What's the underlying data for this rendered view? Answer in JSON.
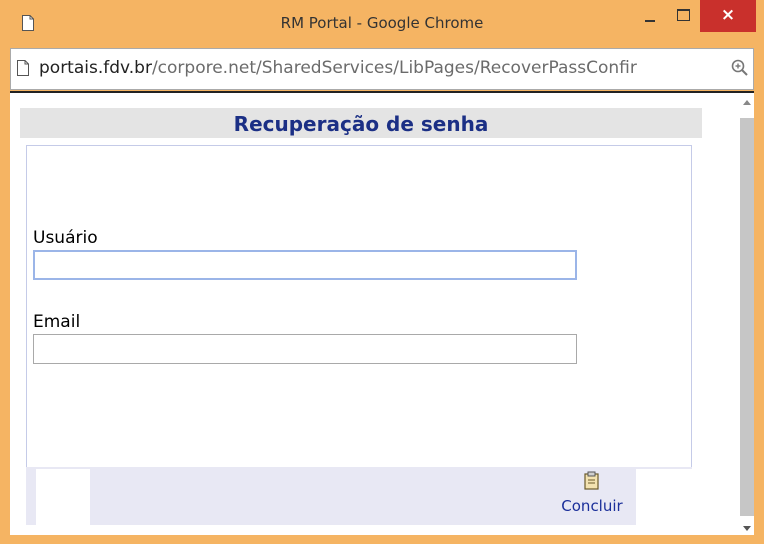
{
  "window": {
    "title": "RM Portal - Google Chrome",
    "close_symbol": "×"
  },
  "address": {
    "domain": "portais.fdv.br",
    "path": "/corpore.net/SharedServices/LibPages/RecoverPassConfir"
  },
  "page": {
    "heading": "Recuperação de senha",
    "fields": {
      "usuario_label": "Usuário",
      "usuario_value": "",
      "email_label": "Email",
      "email_value": ""
    },
    "footer": {
      "concluir_label": "Concluir",
      "concluir_icon": "clipboard-icon"
    }
  },
  "colors": {
    "titlebar": "#f5b463",
    "close_button": "#c9302c",
    "heading_text": "#1b2f85",
    "link_text": "#1b2f9a"
  }
}
